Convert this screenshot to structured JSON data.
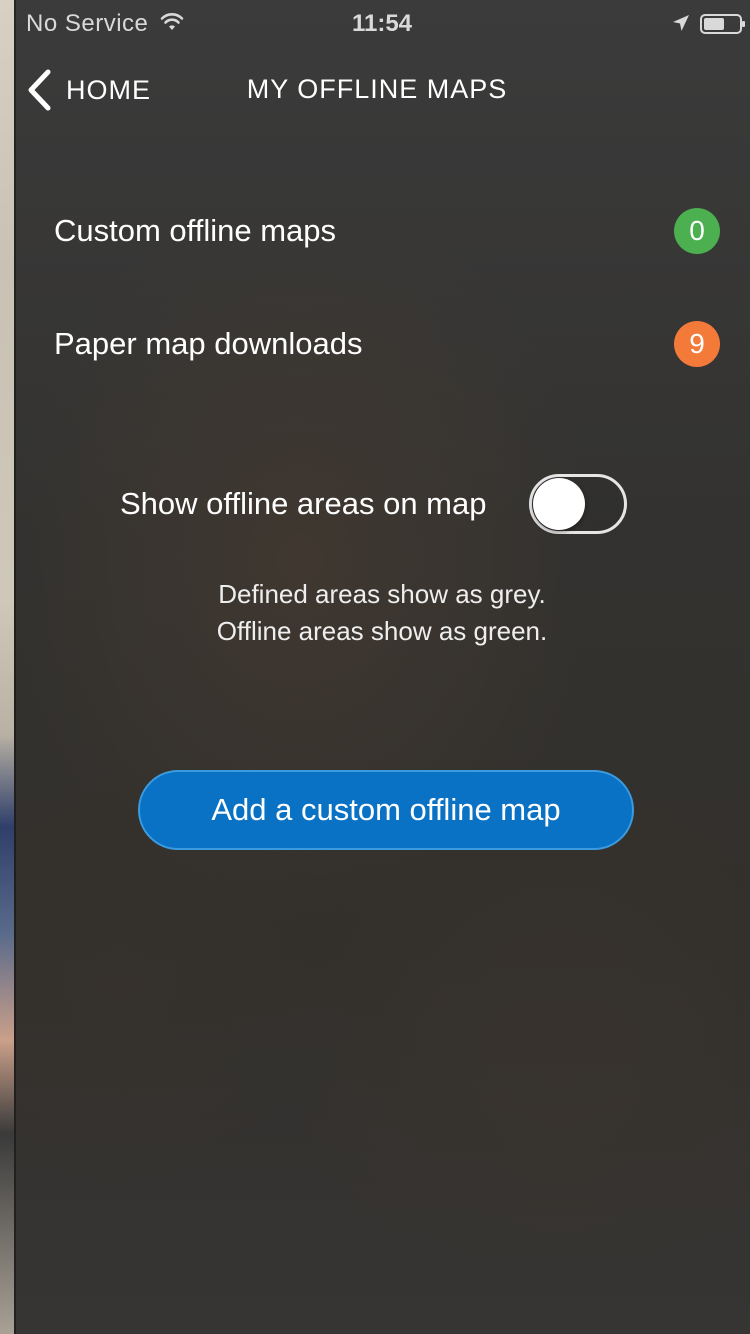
{
  "status_bar": {
    "carrier": "No Service",
    "time": "11:54",
    "icons": [
      "wifi-icon",
      "location-arrow-icon",
      "battery-icon"
    ]
  },
  "nav": {
    "back_label": "HOME",
    "title": "MY OFFLINE MAPS"
  },
  "list": [
    {
      "label": "Custom offline maps",
      "count": "0",
      "badge_color": "#4caf50"
    },
    {
      "label": "Paper map downloads",
      "count": "9",
      "badge_color": "#f47a3a"
    }
  ],
  "toggle": {
    "label": "Show offline areas on map",
    "state": "off"
  },
  "help": {
    "line1": "Defined areas show as grey.",
    "line2": "Offline areas show as green."
  },
  "primary_button": {
    "label": "Add a custom offline map",
    "color": "#0a72c4"
  }
}
